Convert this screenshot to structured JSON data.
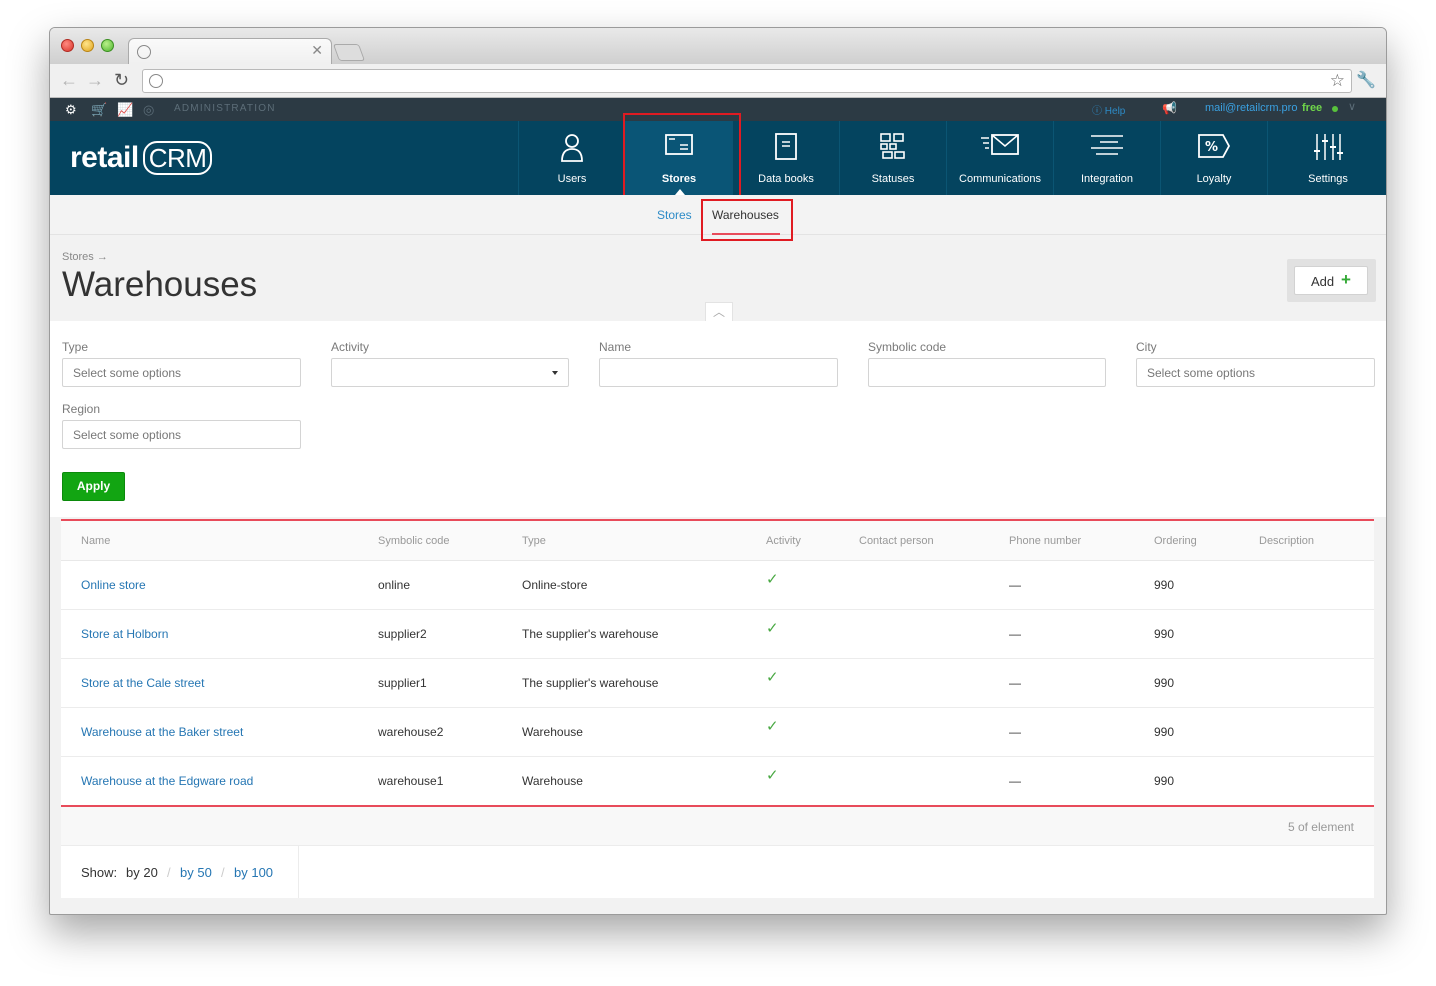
{
  "header": {
    "admin_label": "ADMINISTRATION",
    "help": "Help",
    "email": "mail@retailcrm.pro",
    "plan": "free"
  },
  "logo": {
    "text": "retail",
    "mark": "CRM"
  },
  "nav": [
    {
      "label": "Users",
      "icon": "user-icon"
    },
    {
      "label": "Stores",
      "icon": "store-icon"
    },
    {
      "label": "Data books",
      "icon": "book-icon"
    },
    {
      "label": "Statuses",
      "icon": "statuses-icon"
    },
    {
      "label": "Communications",
      "icon": "mail-icon"
    },
    {
      "label": "Integration",
      "icon": "integration-icon"
    },
    {
      "label": "Loyalty",
      "icon": "percent-tag-icon"
    },
    {
      "label": "Settings",
      "icon": "sliders-icon"
    }
  ],
  "subnav": {
    "stores": "Stores",
    "warehouses": "Warehouses"
  },
  "breadcrumb": "Stores →",
  "page_title": "Warehouses",
  "add_button": "Add",
  "filters": {
    "type": {
      "label": "Type",
      "placeholder": "Select some options"
    },
    "activity": {
      "label": "Activity",
      "value": ""
    },
    "name": {
      "label": "Name",
      "value": ""
    },
    "symbolic_code": {
      "label": "Symbolic code",
      "value": ""
    },
    "city": {
      "label": "City",
      "placeholder": "Select some options"
    },
    "region": {
      "label": "Region",
      "placeholder": "Select some options"
    },
    "apply": "Apply"
  },
  "table": {
    "columns": [
      "Name",
      "Symbolic code",
      "Type",
      "Activity",
      "Contact person",
      "Phone number",
      "Ordering",
      "Description"
    ],
    "rows": [
      {
        "name": "Online store",
        "code": "online",
        "type": "Online-store",
        "active": true,
        "contact": "",
        "phone": "—",
        "ordering": "990",
        "description": ""
      },
      {
        "name": "Store at Holborn",
        "code": "supplier2",
        "type": "The supplier's warehouse",
        "active": true,
        "contact": "",
        "phone": "—",
        "ordering": "990",
        "description": ""
      },
      {
        "name": "Store at the Cale street",
        "code": "supplier1",
        "type": "The supplier's warehouse",
        "active": true,
        "contact": "",
        "phone": "—",
        "ordering": "990",
        "description": ""
      },
      {
        "name": "Warehouse at the Baker street",
        "code": "warehouse2",
        "type": "Warehouse",
        "active": true,
        "contact": "",
        "phone": "—",
        "ordering": "990",
        "description": ""
      },
      {
        "name": "Warehouse at the Edgware road",
        "code": "warehouse1",
        "type": "Warehouse",
        "active": true,
        "contact": "",
        "phone": "—",
        "ordering": "990",
        "description": ""
      }
    ],
    "count": "5  of element"
  },
  "pagination": {
    "show_label": "Show:",
    "options": [
      "by 20",
      "by 50",
      "by 100"
    ],
    "selected": "by 20"
  },
  "colors": {
    "brand": "#04445f",
    "apply": "#12a512",
    "accent": "#e84b5a",
    "link": "#2576b3"
  }
}
